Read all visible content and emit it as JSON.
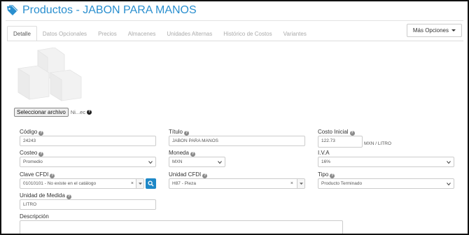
{
  "header": {
    "icon": "price-tag-icon",
    "title": "Productos - JABON PARA MANOS"
  },
  "tabs": [
    {
      "label": "Detalle",
      "active": true
    },
    {
      "label": "Datos Opcionales",
      "active": false
    },
    {
      "label": "Precios",
      "active": false
    },
    {
      "label": "Almacenes",
      "active": false
    },
    {
      "label": "Unidades Alternas",
      "active": false
    },
    {
      "label": "Histórico de Costos",
      "active": false
    },
    {
      "label": "Variantes",
      "active": false
    }
  ],
  "more_options": {
    "label": "Más Opciones"
  },
  "image_upload": {
    "button_label": "Seleccionar archivo",
    "status": "Ni...ec"
  },
  "form": {
    "codigo": {
      "label": "Código",
      "value": "24243"
    },
    "titulo": {
      "label": "Título",
      "value": "JABON PARA MANOS"
    },
    "costo_inicial": {
      "label": "Costo Inicial",
      "value": "122.73",
      "suffix": "MXN  / LITRO"
    },
    "costeo": {
      "label": "Costeo",
      "value": "Promedio"
    },
    "moneda": {
      "label": "Moneda",
      "value": "MXN"
    },
    "iva": {
      "label": "I.V.A",
      "value": "16%"
    },
    "clave_cfdi": {
      "label": "Clave CFDI",
      "value": "01010101 - No existe en el catálogo"
    },
    "unidad_cfdi": {
      "label": "Unidad CFDI",
      "value": "H87 - Pieza"
    },
    "tipo": {
      "label": "Tipo",
      "value": "Producto Terminado"
    },
    "unidad_medida": {
      "label": "Unidad de Medida",
      "value": "LITRO"
    },
    "descripcion": {
      "label": "Descripción",
      "value": ""
    }
  },
  "colors": {
    "accent": "#2a8fcf",
    "search_button": "#1e88c7"
  }
}
